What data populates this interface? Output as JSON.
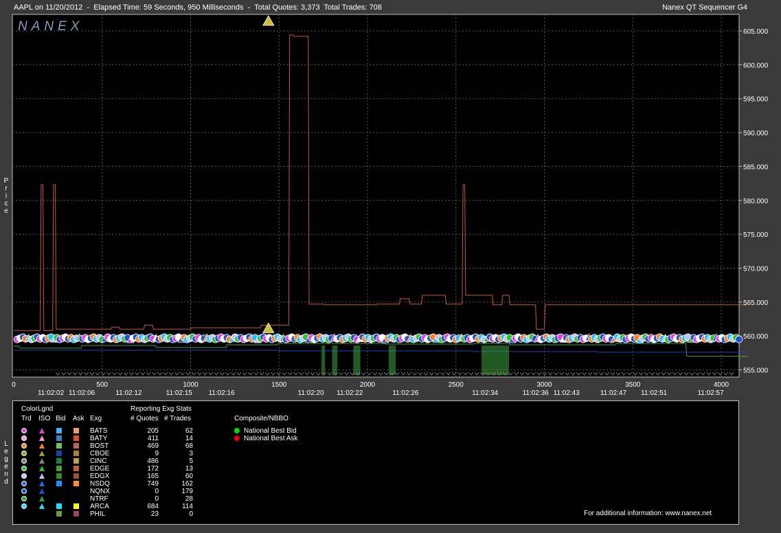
{
  "header": {
    "symbol_line": "AAPL on 11/20/2012  -  Elapsed Time: 59 Seconds, 950 Milliseconds  -  Total Quotes: 3,373  Total Trades: 708",
    "product": "Nanex QT Sequencer G4",
    "watermark": "NANEX"
  },
  "side_labels": {
    "price": "Price",
    "legend": "Legend"
  },
  "colors": {
    "background": "#3a3a3a",
    "plot_bg": "#000000",
    "grid": "#5a5a5a",
    "ask_line": "#c8583a",
    "bid_line": "#3fa33f",
    "nbbo_bid": "#00dd00",
    "nbbo_ask": "#ee0000"
  },
  "chart_data": {
    "type": "line",
    "ylim": [
      554,
      606
    ],
    "xlim": [
      0,
      4150
    ],
    "yticks": [
      555,
      560,
      565,
      570,
      575,
      580,
      585,
      590,
      595,
      600,
      605
    ],
    "ytick_labels": [
      "555.000",
      "560.000",
      "565.000",
      "570.000",
      "575.000",
      "580.000",
      "585.000",
      "590.000",
      "595.000",
      "600.000",
      "605.000"
    ],
    "xticks": [
      0,
      500,
      1000,
      1500,
      2000,
      2500,
      3000,
      3500,
      4000
    ],
    "xtick_labels": [
      "0",
      "500",
      "1000",
      "1500",
      "2000",
      "2500",
      "3000",
      "3500",
      "4000"
    ],
    "time_labels": [
      {
        "x": 210,
        "label": "11:02:02"
      },
      {
        "x": 385,
        "label": "11:02:06"
      },
      {
        "x": 650,
        "label": "11:02:12"
      },
      {
        "x": 935,
        "label": "11:02:15"
      },
      {
        "x": 1175,
        "label": "11:02:16"
      },
      {
        "x": 1680,
        "label": "11:02:20"
      },
      {
        "x": 1900,
        "label": "11:02:22"
      },
      {
        "x": 2215,
        "label": "11:02:26"
      },
      {
        "x": 2665,
        "label": "11:02:34"
      },
      {
        "x": 2950,
        "label": "11:02:36"
      },
      {
        "x": 3125,
        "label": "11:02:43"
      },
      {
        "x": 3390,
        "label": "11:02:47"
      },
      {
        "x": 3620,
        "label": "11:02:51"
      },
      {
        "x": 3940,
        "label": "11:02:57"
      }
    ],
    "series": [
      {
        "kind": "ask",
        "x": [
          0,
          150,
          155,
          165,
          170,
          220,
          225,
          235,
          240,
          550,
          555,
          595,
          600,
          735,
          740,
          785,
          790,
          1000,
          1005,
          1395,
          1400,
          1555,
          1560,
          1580,
          1585,
          1665,
          1670,
          1685,
          1690,
          1750,
          1755,
          2050,
          2055,
          2180,
          2185,
          2235,
          2240,
          2305,
          2310,
          2440,
          2445,
          2535,
          2540,
          2550,
          2555,
          2705,
          2710,
          2760,
          2765,
          2800,
          2805,
          2950,
          2955,
          3000,
          3005,
          3140,
          3145,
          3250,
          3255,
          4150
        ],
        "y": [
          560.8,
          560.8,
          582.3,
          582.3,
          560.8,
          560.8,
          582.3,
          582.3,
          561.0,
          561.0,
          561.3,
          561.3,
          561.0,
          561.0,
          561.6,
          561.6,
          561.0,
          561.0,
          561.2,
          561.2,
          561.6,
          561.6,
          604.4,
          604.4,
          604.2,
          604.2,
          564.7,
          564.7,
          564.7,
          564.7,
          564.6,
          564.6,
          564.7,
          564.7,
          565.5,
          565.5,
          564.7,
          564.7,
          566.0,
          566.0,
          564.7,
          564.7,
          582.3,
          582.3,
          566.0,
          566.0,
          564.6,
          564.6,
          566.0,
          566.0,
          564.6,
          564.6,
          561.0,
          561.0,
          564.6,
          564.6,
          564.6,
          564.6,
          564.6,
          564.6
        ]
      },
      {
        "kind": "bid",
        "x": [
          0,
          30,
          35,
          380,
          385,
          800,
          805,
          1200,
          1205,
          1490,
          1495,
          2100,
          2105,
          2600,
          2605,
          2800,
          2805,
          3400,
          3405,
          3800,
          3805,
          4150
        ],
        "y": [
          558.5,
          558.5,
          558.2,
          558.2,
          558.6,
          558.6,
          558.3,
          558.3,
          558.7,
          558.7,
          558.9,
          558.9,
          558.8,
          558.8,
          558.9,
          558.9,
          558.7,
          558.7,
          558.9,
          558.9,
          557.0,
          557.0
        ]
      },
      {
        "kind": "blue",
        "x": [
          0,
          1500,
          1505,
          2600,
          2605,
          3300,
          3305,
          4150
        ],
        "y": [
          557.9,
          557.9,
          557.8,
          557.8,
          557.7,
          557.7,
          557.6,
          557.6
        ]
      }
    ],
    "trades": {
      "colors": [
        "#e040e0",
        "#ffffff",
        "#1f58c8",
        "#ff8020",
        "#20c0ff",
        "#c0c0ff",
        "#30c030",
        "#2050d0"
      ],
      "x_start": 20,
      "x_step": 16,
      "count": 256,
      "price_base": 559.5
    },
    "nbbo_segments": [
      {
        "x0": 2720,
        "x1": 2760,
        "y": 559.9
      }
    ],
    "triangle_top": {
      "x": 1440,
      "y": 606.5
    },
    "triangle_mid": {
      "x": 1440,
      "y": 561.2
    }
  },
  "legend": {
    "col_headers": {
      "color_legend": "ColorLgnd",
      "trd": "Trd",
      "iso": "ISO",
      "bid": "Bid",
      "ask": "Ask",
      "exg": "Exg",
      "stats_title": "Reporting Exg Stats",
      "quotes": "# Quotes",
      "trades": "# Trades",
      "composite": "Composite/NBBO"
    },
    "rows": [
      {
        "exg": "BATS",
        "quotes": "205",
        "trades": "62",
        "trd": "#e040e0",
        "iso": "#e040e0",
        "bid": "#40b0ff",
        "ask": "#f0a060"
      },
      {
        "exg": "BATY",
        "quotes": "411",
        "trades": "14",
        "trd": "#f0a0c0",
        "iso": "#f0a0c0",
        "bid": "#4080c0",
        "ask": "#e05030"
      },
      {
        "exg": "BOST",
        "quotes": "469",
        "trades": "68",
        "trd": "#ff8020",
        "iso": "#ff8020",
        "bid": "#70c060",
        "ask": "#c06060"
      },
      {
        "exg": "CBOE",
        "quotes": "9",
        "trades": "3",
        "trd": "#a0a030",
        "iso": "#a0a030",
        "bid": "#2040a0",
        "ask": "#b08030"
      },
      {
        "exg": "CINC",
        "quotes": "486",
        "trades": "5",
        "trd": "#808080",
        "iso": "#808080",
        "bid": "#208040",
        "ask": "#c0a040"
      },
      {
        "exg": "EDGE",
        "quotes": "172",
        "trades": "13",
        "trd": "#30c030",
        "iso": "#30c030",
        "bid": "#40a040",
        "ask": "#c06040"
      },
      {
        "exg": "EDGX",
        "quotes": "165",
        "trades": "60",
        "trd": "#c0c0ff",
        "iso": "#c0c0ff",
        "bid": "#309030",
        "ask": "#a05030"
      },
      {
        "exg": "NSDQ",
        "quotes": "749",
        "trades": "162",
        "trd": "#2070e0",
        "iso": "#2070e0",
        "bid": "#2090ff",
        "ask": "#ff9020"
      },
      {
        "exg": "NQNX",
        "quotes": "0",
        "trades": "179",
        "trd": "#2050d0",
        "iso": "#2050d0",
        "bid": "",
        "ask": ""
      },
      {
        "exg": "NTRF",
        "quotes": "0",
        "trades": "28",
        "trd": "#30a030",
        "iso": "#30a030",
        "bid": "",
        "ask": ""
      },
      {
        "exg": "ARCA",
        "quotes": "684",
        "trades": "114",
        "trd": "#20e0ff",
        "iso": "#20e0ff",
        "bid": "#20e0ff",
        "ask": "#ffff00"
      },
      {
        "exg": "PHIL",
        "quotes": "23",
        "trades": "0",
        "trd": "",
        "iso": "",
        "bid": "#60a040",
        "ask": "#a04060"
      }
    ],
    "composite": [
      {
        "label": "National Best Bid",
        "color": "#00dd00"
      },
      {
        "label": "National Best Ask",
        "color": "#ee0000"
      }
    ],
    "footer": "For additional information: www.nanex.net"
  }
}
